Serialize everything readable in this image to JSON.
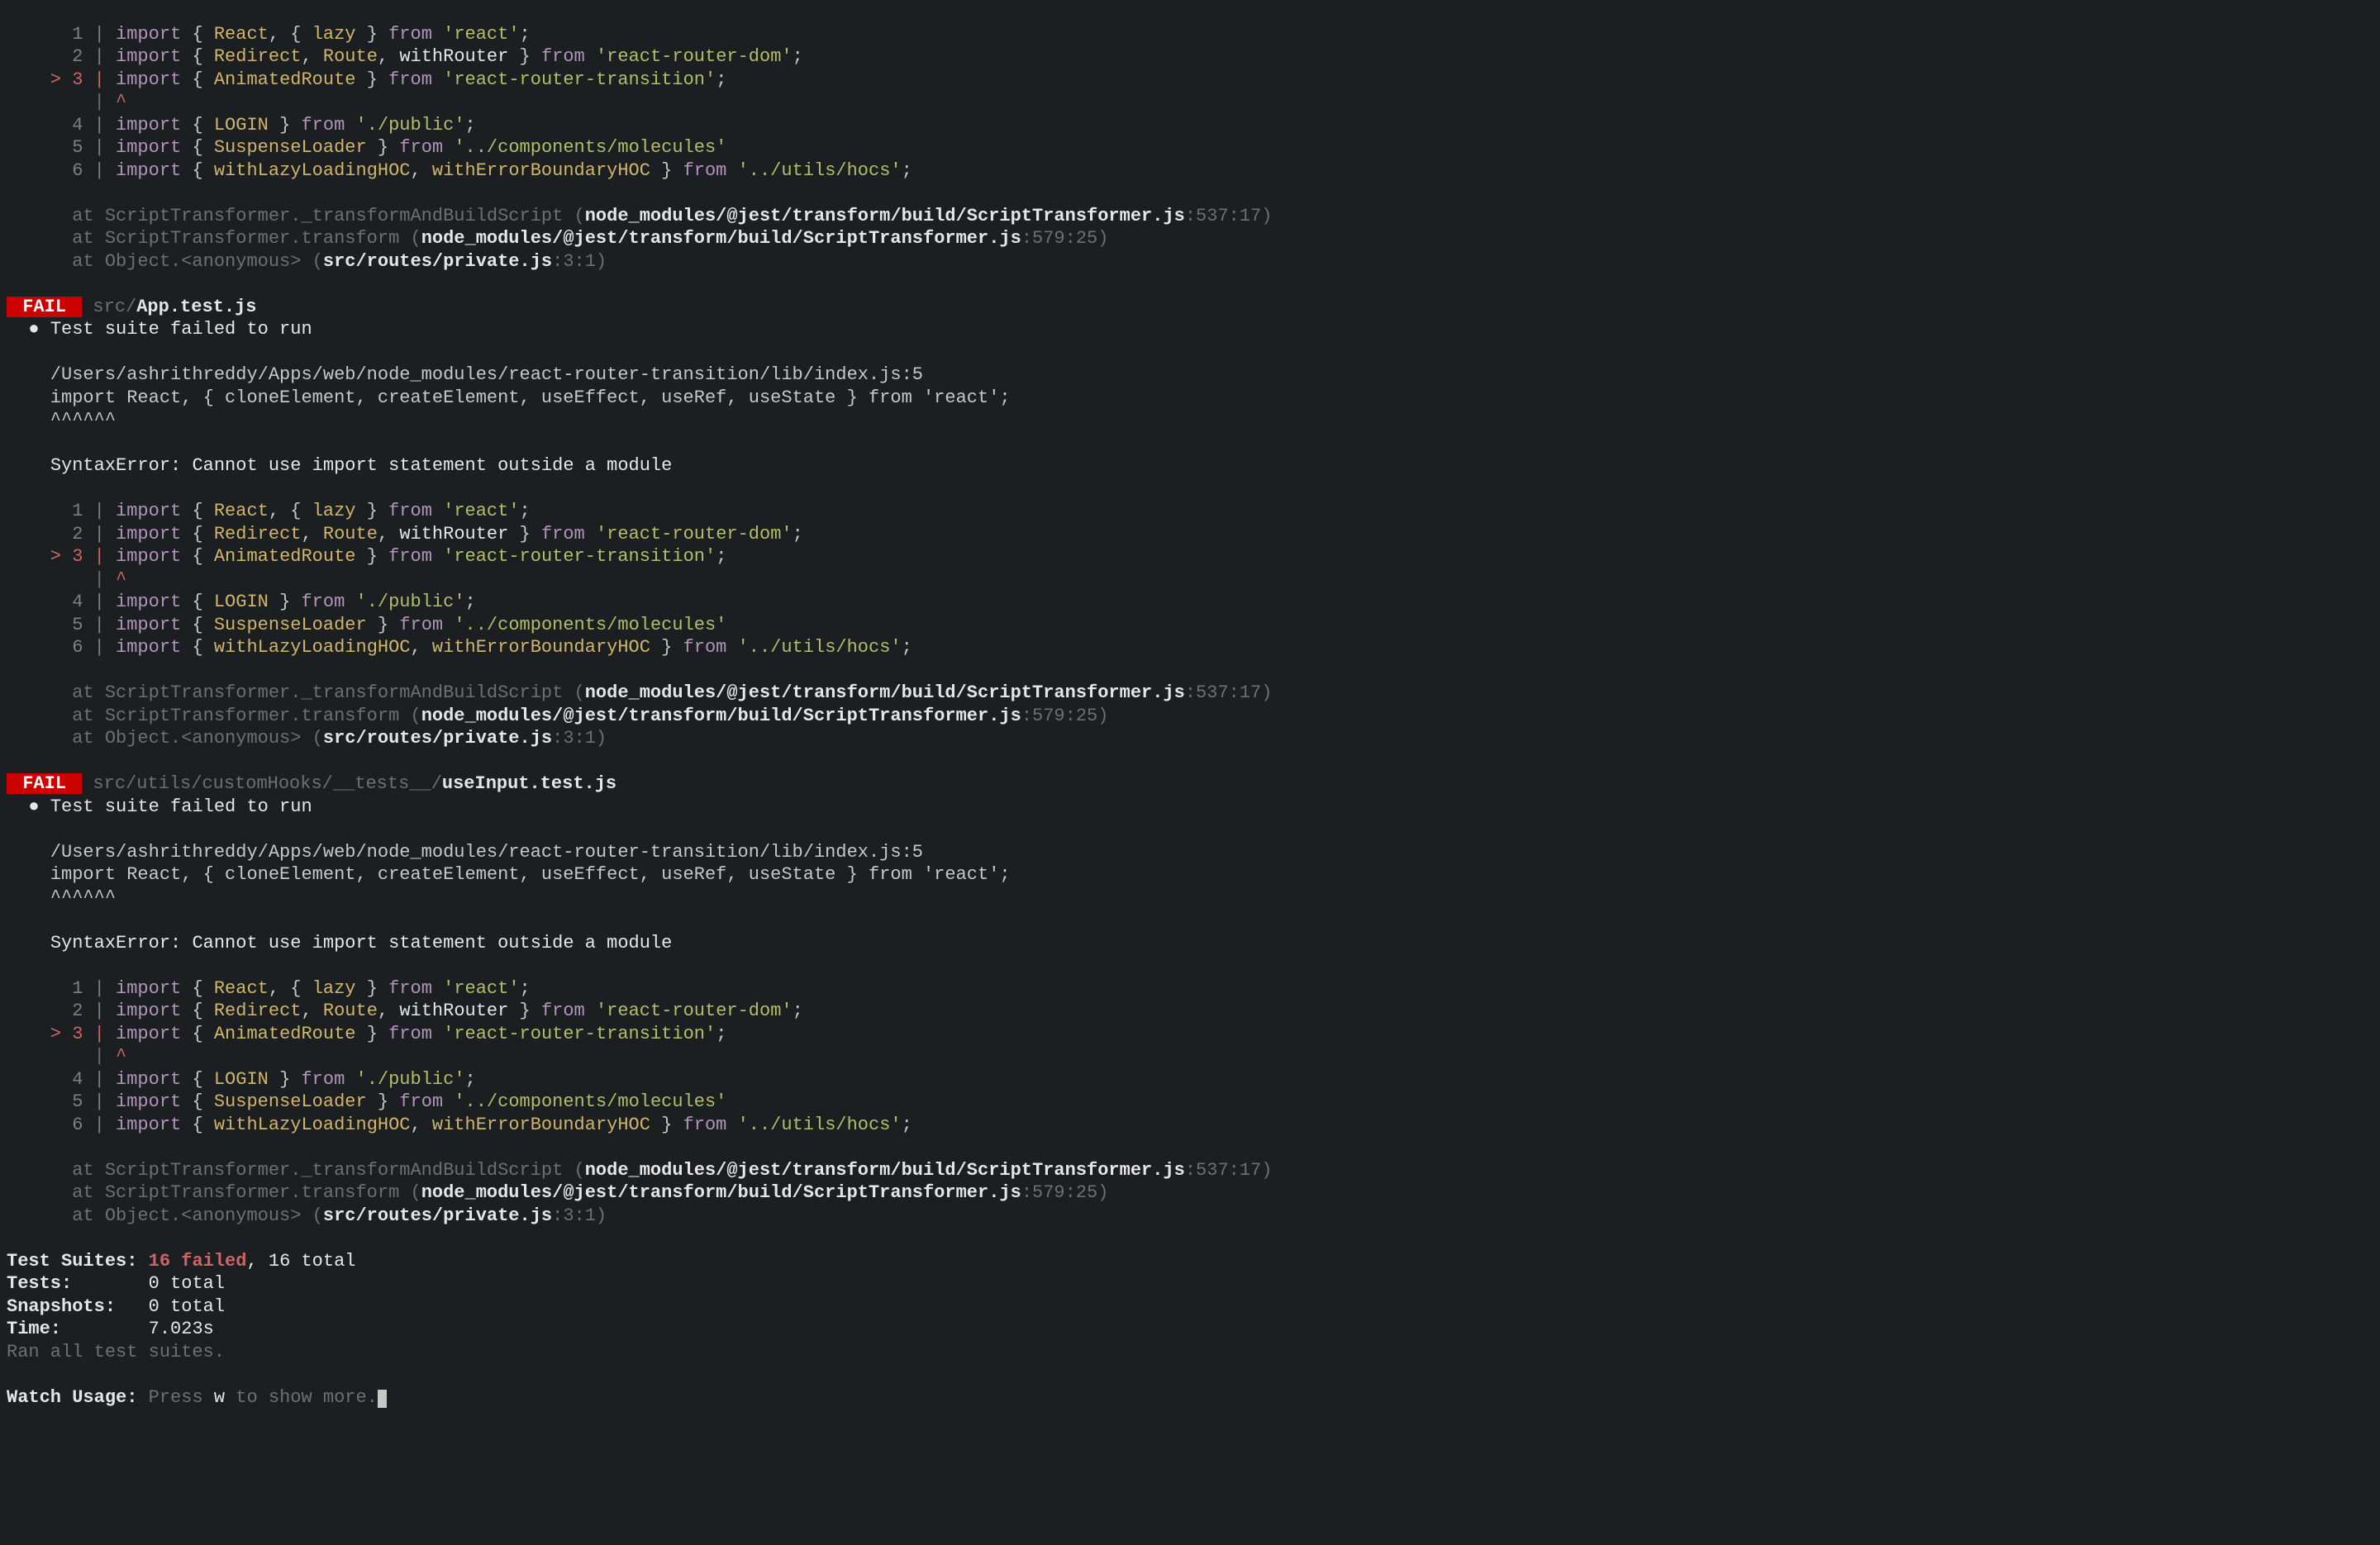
{
  "code_block": {
    "lines": [
      {
        "n": "1",
        "tokens": [
          [
            "import",
            "kw"
          ],
          [
            " { "
          ],
          [
            "React",
            "yel"
          ],
          [
            ", { "
          ],
          [
            "lazy",
            "yel"
          ],
          [
            " } "
          ],
          [
            "from",
            "kw"
          ],
          [
            " "
          ],
          [
            "'react'",
            "olive"
          ],
          [
            ";"
          ]
        ]
      },
      {
        "n": "2",
        "tokens": [
          [
            "import",
            "kw"
          ],
          [
            " { "
          ],
          [
            "Redirect",
            "yel"
          ],
          [
            ", "
          ],
          [
            "Route",
            "yel"
          ],
          [
            ", "
          ],
          [
            "withRouter",
            "white"
          ],
          [
            " } "
          ],
          [
            "from",
            "kw"
          ],
          [
            " "
          ],
          [
            "'react-router-dom'",
            "olive"
          ],
          [
            ";"
          ]
        ]
      },
      {
        "n": "3",
        "err": true,
        "tokens": [
          [
            "import",
            "kw"
          ],
          [
            " { "
          ],
          [
            "AnimatedRoute",
            "yel"
          ],
          [
            " } "
          ],
          [
            "from",
            "kw"
          ],
          [
            " "
          ],
          [
            "'react-router-transition'",
            "olive"
          ],
          [
            ";"
          ]
        ]
      },
      {
        "caret": true
      },
      {
        "n": "4",
        "tokens": [
          [
            "import",
            "kw"
          ],
          [
            " { "
          ],
          [
            "LOGIN",
            "yel"
          ],
          [
            " } "
          ],
          [
            "from",
            "kw"
          ],
          [
            " "
          ],
          [
            "'./public'",
            "olive"
          ],
          [
            ";"
          ]
        ]
      },
      {
        "n": "5",
        "tokens": [
          [
            "import",
            "kw"
          ],
          [
            " { "
          ],
          [
            "SuspenseLoader",
            "yel"
          ],
          [
            " } "
          ],
          [
            "from",
            "kw"
          ],
          [
            " "
          ],
          [
            "'../components/molecules'",
            "olive"
          ]
        ]
      },
      {
        "n": "6",
        "tokens": [
          [
            "import",
            "kw"
          ],
          [
            " { "
          ],
          [
            "withLazyLoadingHOC",
            "yel"
          ],
          [
            ", "
          ],
          [
            "withErrorBoundaryHOC",
            "yel"
          ],
          [
            " } "
          ],
          [
            "from",
            "kw"
          ],
          [
            " "
          ],
          [
            "'../utils/hocs'",
            "olive"
          ],
          [
            ";"
          ]
        ]
      }
    ]
  },
  "stack_lines": [
    {
      "prefix": "      at ScriptTransformer._transformAndBuildScript (",
      "path": "node_modules/@jest/transform/build/ScriptTransformer.js",
      "loc": ":537:17)"
    },
    {
      "prefix": "      at ScriptTransformer.transform (",
      "path": "node_modules/@jest/transform/build/ScriptTransformer.js",
      "loc": ":579:25)"
    },
    {
      "prefix": "      at Object.<anonymous> (",
      "path": "src/routes/private.js",
      "loc": ":3:1)"
    }
  ],
  "suites": [
    {
      "path_prefix": "src/",
      "file": "App.test.js"
    },
    {
      "path_prefix": "src/utils/customHooks/__tests__/",
      "file": "useInput.test.js"
    }
  ],
  "failure_msg": "Test suite failed to run",
  "error_path": "/Users/ashrithreddy/Apps/web/node_modules/react-router-transition/lib/index.js:5",
  "error_import_line": "import React, { cloneElement, createElement, useEffect, useRef, useState } from 'react';",
  "caret_row": "^^^^^^",
  "syntax_error": "SyntaxError: Cannot use import statement outside a module",
  "fail_label": " FAIL ",
  "summary": {
    "test_suites_label": "Test Suites:",
    "test_suites_failed": "16 failed",
    "test_suites_total": ", 16 total",
    "tests_label": "Tests:",
    "tests_value": "0 total",
    "snapshots_label": "Snapshots:",
    "snapshots_value": "0 total",
    "time_label": "Time:",
    "time_value": "7.023s",
    "ran_all": "Ran all test suites."
  },
  "watch": {
    "label": "Watch Usage:",
    "press": "Press ",
    "key": "w",
    "rest": " to show more."
  }
}
